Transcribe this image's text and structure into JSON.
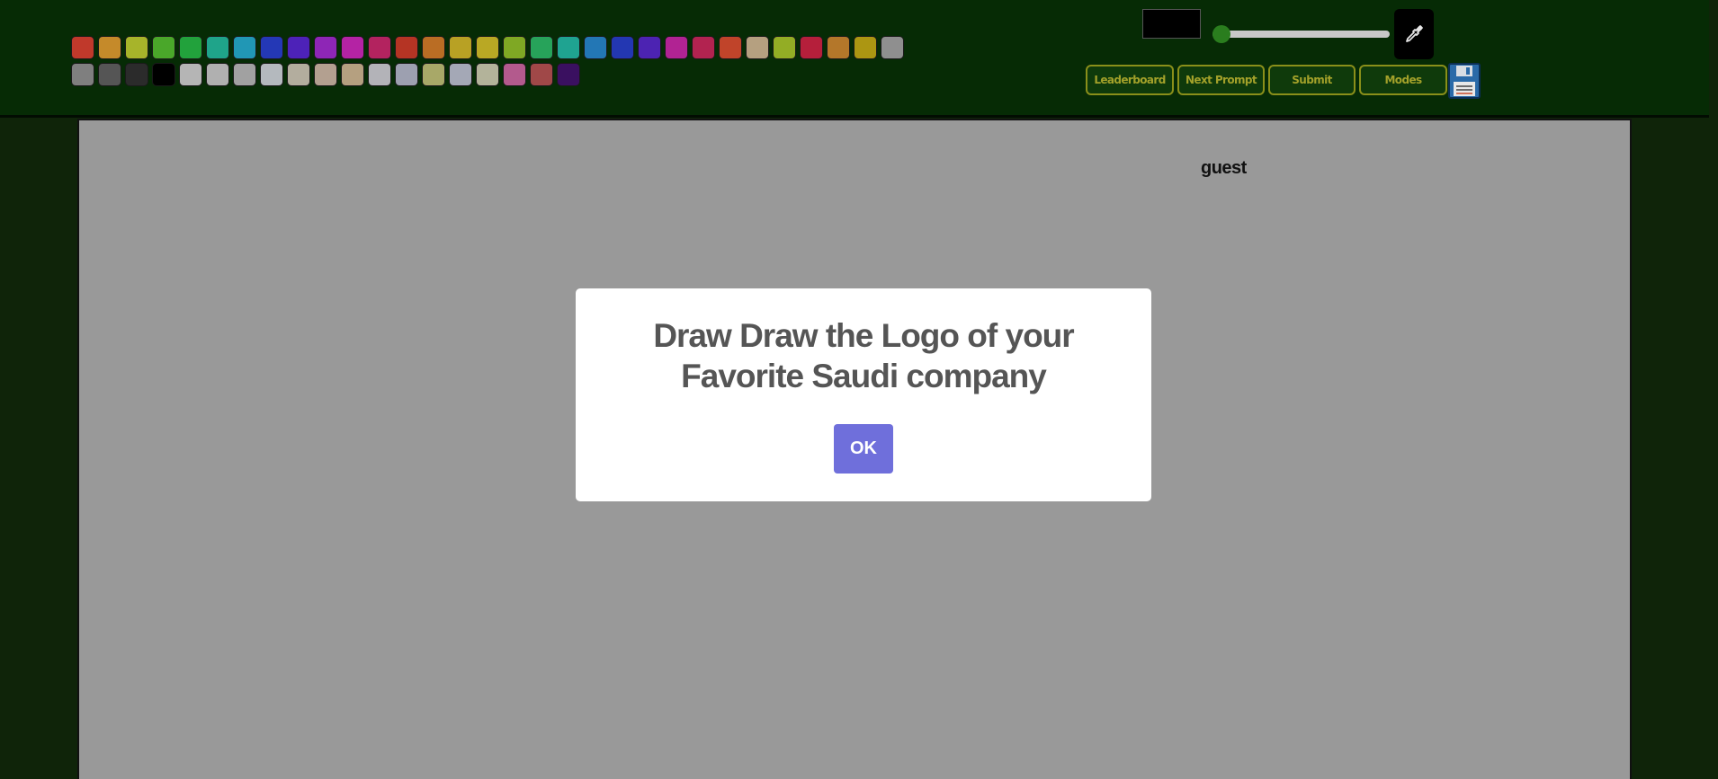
{
  "palette": {
    "row1": [
      "#c0392b",
      "#c58a2a",
      "#a7b42a",
      "#4aa72a",
      "#22a23c",
      "#1fa48a",
      "#2197b5",
      "#2438b6",
      "#4d22b8",
      "#8e26b6",
      "#b423a4",
      "#b3235f",
      "#b53424",
      "#ba6d24",
      "#b8a124",
      "#b9a824",
      "#7fa824",
      "#27a35a",
      "#1fa391",
      "#2377b5",
      "#2337b2",
      "#4c23b2",
      "#b12393",
      "#b22350",
      "#c0442a",
      "#b5a080",
      "#93ad25",
      "#b51f3b",
      "#b4772a",
      "#ac9612",
      "#8f8f8f"
    ],
    "row2": [
      "#7f7f7f",
      "#555555",
      "#2b2b2b",
      "#000000",
      "#b5b5b5",
      "#b0b0b0",
      "#a1a1a1",
      "#b4b9be",
      "#b3ad9e",
      "#b3a090",
      "#b5a080",
      "#b3b3b8",
      "#9da0b0",
      "#a8a868",
      "#a4a8b6",
      "#b3b39a",
      "#b35a8d",
      "#a04848",
      "#3a1060"
    ]
  },
  "colors": {
    "accent": "#6f6fdb",
    "topbar": "#062b05",
    "canvas": "#999999",
    "button_border": "#8a8f1a",
    "button_text": "#a3a12a"
  },
  "toolbar": {
    "leaderboard_label": "Leaderboard",
    "next_prompt_label": "Next Prompt",
    "submit_label": "Submit",
    "modes_label": "Modes",
    "eyedropper_icon": "eyedropper-icon",
    "save_icon": "floppy-disk-icon",
    "brush_size": 0
  },
  "canvas": {
    "username": "guest"
  },
  "modal": {
    "title": "Draw Draw the Logo of your Favorite Saudi company",
    "ok_label": "OK"
  }
}
